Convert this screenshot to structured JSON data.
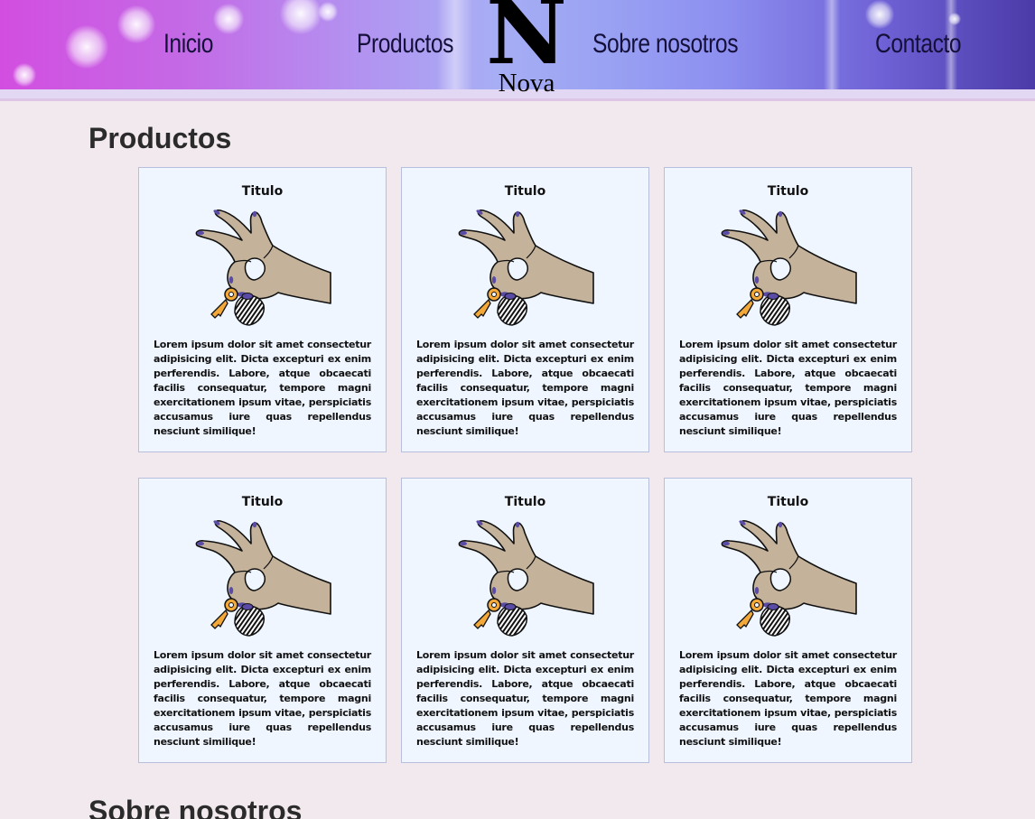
{
  "nav": {
    "items": [
      {
        "label": "Inicio"
      },
      {
        "label": "Productos"
      },
      {
        "label": "Sobre nosotros"
      },
      {
        "label": "Contacto"
      }
    ],
    "logo": {
      "letter": "N",
      "word": "Nova"
    }
  },
  "colors": {
    "page_bg": "#f1e9ee",
    "card_bg": "#eff6ff",
    "nav_text": "#15103a",
    "hand_fill": "#c4b29a",
    "nail_color": "#5a4ba6",
    "key_color": "#f3a93a"
  },
  "products": {
    "title": "Productos",
    "cards": [
      {
        "title": "Titulo",
        "image_icon": "hand-holding-keys-icon",
        "text": "Lorem ipsum dolor sit amet consectetur adipisicing elit. Dicta excepturi ex enim perferendis. Labore, atque obcaecati facilis consequatur, tempore magni exercitationem ipsum vitae, perspiciatis accusamus iure quas repellendus nesciunt similique!"
      },
      {
        "title": "Titulo",
        "image_icon": "hand-holding-keys-icon",
        "text": "Lorem ipsum dolor sit amet consectetur adipisicing elit. Dicta excepturi ex enim perferendis. Labore, atque obcaecati facilis consequatur, tempore magni exercitationem ipsum vitae, perspiciatis accusamus iure quas repellendus nesciunt similique!"
      },
      {
        "title": "Titulo",
        "image_icon": "hand-holding-keys-icon",
        "text": "Lorem ipsum dolor sit amet consectetur adipisicing elit. Dicta excepturi ex enim perferendis. Labore, atque obcaecati facilis consequatur, tempore magni exercitationem ipsum vitae, perspiciatis accusamus iure quas repellendus nesciunt similique!"
      },
      {
        "title": "Titulo",
        "image_icon": "hand-holding-keys-icon",
        "text": "Lorem ipsum dolor sit amet consectetur adipisicing elit. Dicta excepturi ex enim perferendis. Labore, atque obcaecati facilis consequatur, tempore magni exercitationem ipsum vitae, perspiciatis accusamus iure quas repellendus nesciunt similique!"
      },
      {
        "title": "Titulo",
        "image_icon": "hand-holding-keys-icon",
        "text": "Lorem ipsum dolor sit amet consectetur adipisicing elit. Dicta excepturi ex enim perferendis. Labore, atque obcaecati facilis consequatur, tempore magni exercitationem ipsum vitae, perspiciatis accusamus iure quas repellendus nesciunt similique!"
      },
      {
        "title": "Titulo",
        "image_icon": "hand-holding-keys-icon",
        "text": "Lorem ipsum dolor sit amet consectetur adipisicing elit. Dicta excepturi ex enim perferendis. Labore, atque obcaecati facilis consequatur, tempore magni exercitationem ipsum vitae, perspiciatis accusamus iure quas repellendus nesciunt similique!"
      }
    ]
  },
  "about": {
    "title": "Sobre nosotros"
  }
}
